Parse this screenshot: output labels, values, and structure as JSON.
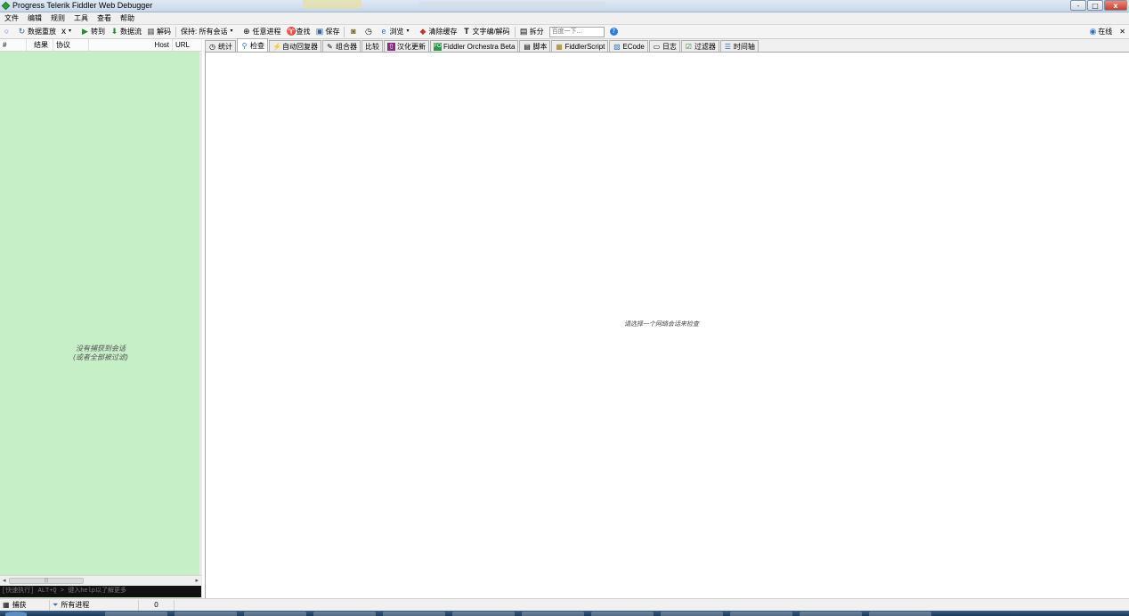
{
  "window": {
    "title": "Progress Telerik Fiddler Web Debugger",
    "buttons": [
      "-",
      "□",
      "x"
    ]
  },
  "menu": [
    "文件",
    "编辑",
    "规则",
    "工具",
    "查看",
    "帮助"
  ],
  "toolbar": {
    "replay": "数据重放",
    "remove": "x",
    "go": "转到",
    "stream": "数据流",
    "decode": "解码",
    "keep": "保持: 所有会话",
    "any_process": "任意进程",
    "find": "查找",
    "save": "保存",
    "browse": "浏览",
    "clear_cache": "清除缓存",
    "text_encoder": "文字编/解码",
    "tearoff": "拆分",
    "search_placeholder": "百度一下...",
    "online": "在线"
  },
  "session_list": {
    "columns": [
      "#",
      "结果",
      "协议",
      "Host",
      "URL"
    ],
    "empty_line1": "没有捕获到会话",
    "empty_line2": "(或者全部被过滤)",
    "quickexec": "[快速执行] ALT+Q > 键入help以了解更多"
  },
  "tabs": [
    {
      "label": "统计",
      "icon": "stopwatch-icon"
    },
    {
      "label": "检查",
      "icon": "magnifier-icon",
      "active": true
    },
    {
      "label": "自动回复器",
      "icon": "lightning-icon"
    },
    {
      "label": "组合器",
      "icon": "compose-icon"
    },
    {
      "label": "比较",
      "icon": ""
    },
    {
      "label": "汉化更新",
      "icon": "update-icon"
    },
    {
      "label": "Fiddler Orchestra Beta",
      "icon": "orchestra-icon"
    },
    {
      "label": "脚本",
      "icon": "script-icon"
    },
    {
      "label": "FiddlerScript",
      "icon": "fiddlerscript-icon"
    },
    {
      "label": "ECode",
      "icon": "ecode-icon"
    },
    {
      "label": "日志",
      "icon": "log-icon"
    },
    {
      "label": "过滤器",
      "icon": "filter-icon"
    },
    {
      "label": "时间轴",
      "icon": "timeline-icon"
    }
  ],
  "content": {
    "message": "请选择一个网络会话来检查"
  },
  "statusbar": {
    "capturing": "捕获",
    "process_filter": "所有进程",
    "count": "0"
  },
  "colors": {
    "session_list_bg": "#c7efc7",
    "quickexec_bg": "#111111"
  }
}
